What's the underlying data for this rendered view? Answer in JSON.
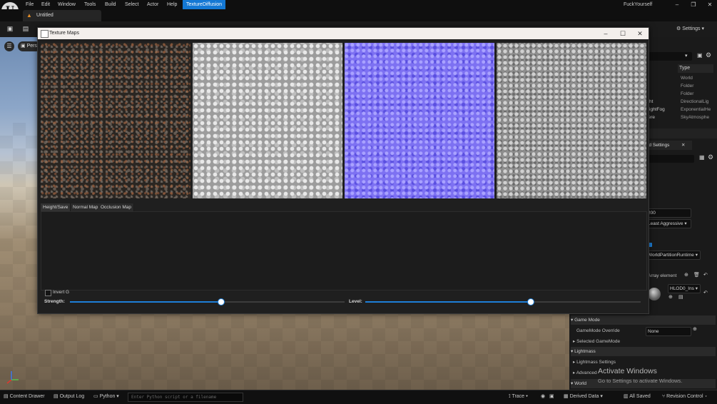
{
  "menubar": {
    "items": [
      "File",
      "Edit",
      "Window",
      "Tools",
      "Build",
      "Select",
      "Actor",
      "Help"
    ],
    "plugin": "TextureDiffusion",
    "user": "FuckYourself"
  },
  "doc_tab": {
    "title": "Untitled"
  },
  "toolbar": {
    "settings": "Settings"
  },
  "viewport": {
    "perspective": "Pers"
  },
  "outliner": {
    "type_header": "Type",
    "rows": [
      {
        "name": "",
        "type": "World"
      },
      {
        "name": "",
        "type": "Folder"
      },
      {
        "name": "",
        "type": "Folder"
      },
      {
        "name": "ight",
        "type": "DirectionalLig"
      },
      {
        "name": "leightFog",
        "type": "ExponentialHe"
      },
      {
        "name": "here",
        "type": "SkyAtmosphe"
      },
      {
        "name": "",
        "type": "SkyLight"
      }
    ]
  },
  "details": {
    "tab": "ld Settings",
    "value_200": "200",
    "least_aggressive": "Least Aggressive",
    "partition": "WorldPartitionRuntime",
    "array_element": "Array element",
    "hlod": "HLOD0_Ins",
    "sections": [
      "Game Mode",
      "Lightmass",
      "World"
    ],
    "gamemode_override_label": "GameMode Override",
    "gamemode_override_value": "None",
    "selected_gamemode": "Selected GameMode",
    "lightmass_settings": "Lightmass Settings",
    "advanced": "Advanced"
  },
  "windows_notice": {
    "title": "Activate Windows",
    "subtitle": "Go to Settings to activate Windows."
  },
  "statusbar": {
    "content_drawer": "Content Drawer",
    "output_log": "Output Log",
    "python": "Python",
    "python_placeholder": "Enter Python script or a filename",
    "trace": "Trace",
    "derived_data": "Derived Data",
    "all_saved": "All Saved",
    "revision_control": "Revision Control"
  },
  "dialog": {
    "title": "Texture Maps",
    "tabs": [
      "Height/Save",
      "Normal Map",
      "Occlusion Map"
    ],
    "invert_label": "Invert G",
    "invert_checked": false,
    "strength_label": "Strength:",
    "strength_value": 0.55,
    "level_label": "Level:",
    "level_value": 0.6
  }
}
